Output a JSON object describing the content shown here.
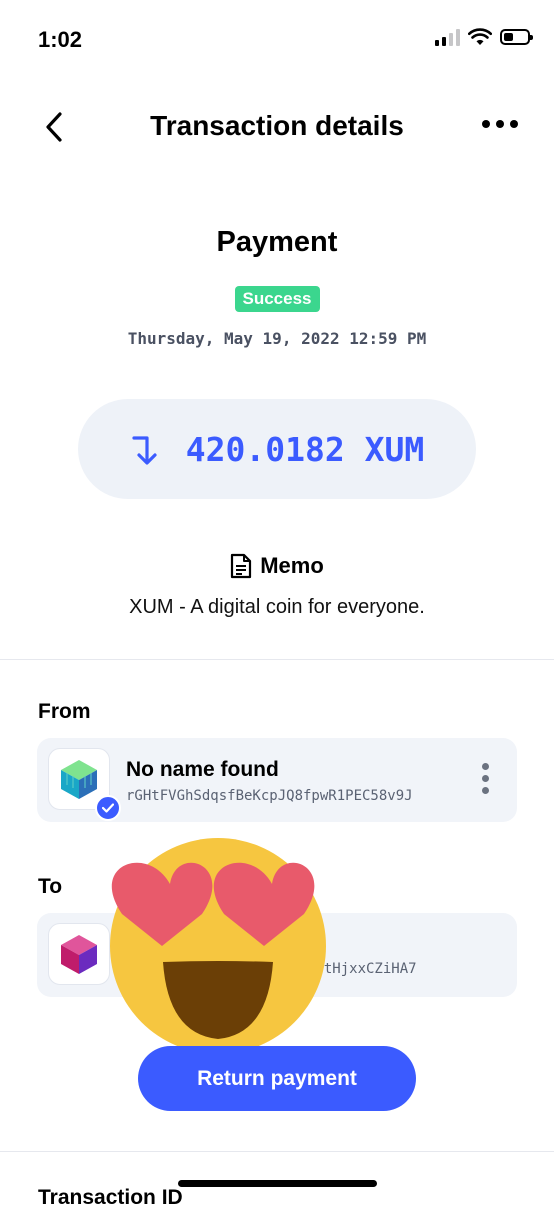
{
  "status_bar": {
    "time": "1:02"
  },
  "header": {
    "title": "Transaction details"
  },
  "transaction": {
    "type": "Payment",
    "status": "Success",
    "date": "Thursday, May 19, 2022 12:59 PM",
    "amount": "420.0182 XUM",
    "memo_title": "Memo",
    "memo_text": "XUM - A digital coin for everyone."
  },
  "from": {
    "label": "From",
    "name": "No name found",
    "address": "rGHtFVGhSdqsfBeKcpJQ8fpwR1PEC58v9J"
  },
  "to": {
    "label": "To",
    "address_visible": "kWtHjxxCZiHA7"
  },
  "actions": {
    "return_label": "Return payment"
  },
  "next_section": {
    "label": "Transaction ID"
  },
  "colors": {
    "accent": "#3b5bff",
    "success": "#3bd68e",
    "pill_bg": "#eef2f8"
  }
}
